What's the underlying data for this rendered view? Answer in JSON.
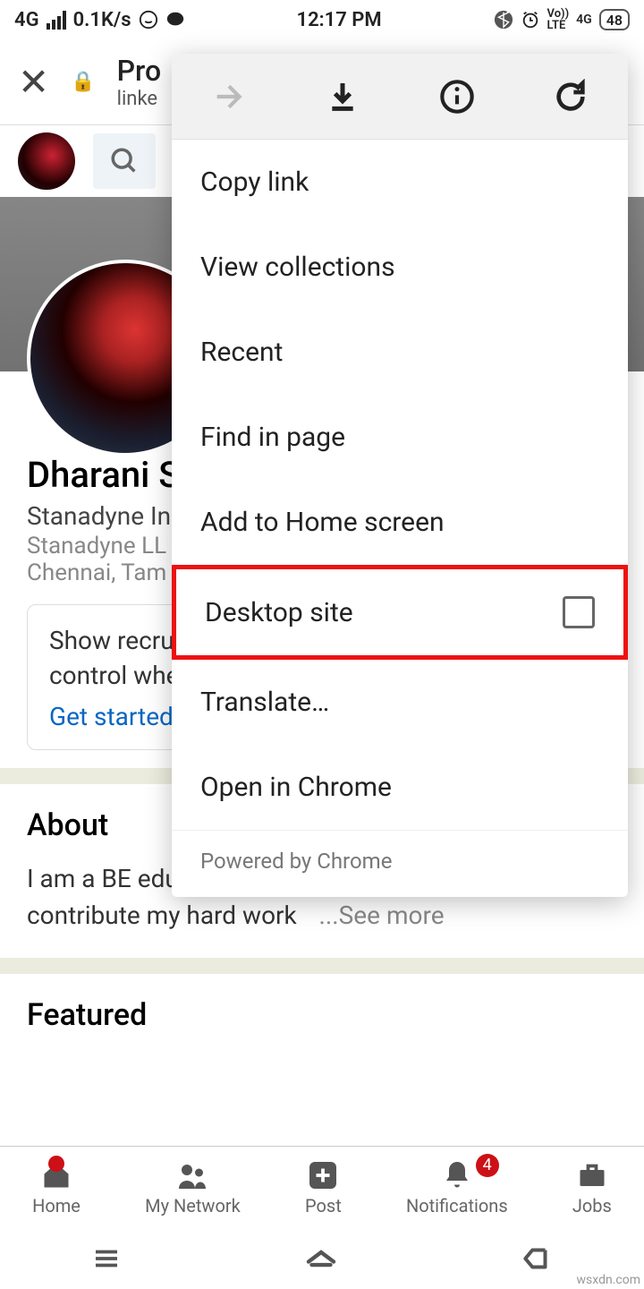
{
  "statusbar": {
    "network": "4G",
    "speed": "0.1K/s",
    "time": "12:17 PM",
    "lte": "LTE",
    "vol": "Vo))\n",
    "net2": "4G",
    "battery": "48"
  },
  "browser": {
    "title": "Pro",
    "subtitle": "linke"
  },
  "profile": {
    "name": "Dharani S",
    "line1": "Stanadyne In",
    "line2": "Stanadyne LL",
    "line3": "Chennai, Tam"
  },
  "recruit": {
    "line1": "Show recru",
    "line2": "control whe",
    "cta": "Get started"
  },
  "about": {
    "heading": "About",
    "text": "I am a BE educated Electronics Graduate, willing to contribute my hard work",
    "more": "...See more"
  },
  "featured": {
    "heading": "Featured"
  },
  "nav": {
    "home": "Home",
    "network": "My Network",
    "post": "Post",
    "notifications": "Notifications",
    "jobs": "Jobs",
    "notif_count": "4"
  },
  "menu": {
    "copy_link": "Copy link",
    "view_collections": "View collections",
    "recent": "Recent",
    "find_in_page": "Find in page",
    "add_home": "Add to Home screen",
    "desktop_site": "Desktop site",
    "translate": "Translate…",
    "open_chrome": "Open in Chrome",
    "footer": "Powered by Chrome"
  },
  "watermark": "wsxdn.com"
}
